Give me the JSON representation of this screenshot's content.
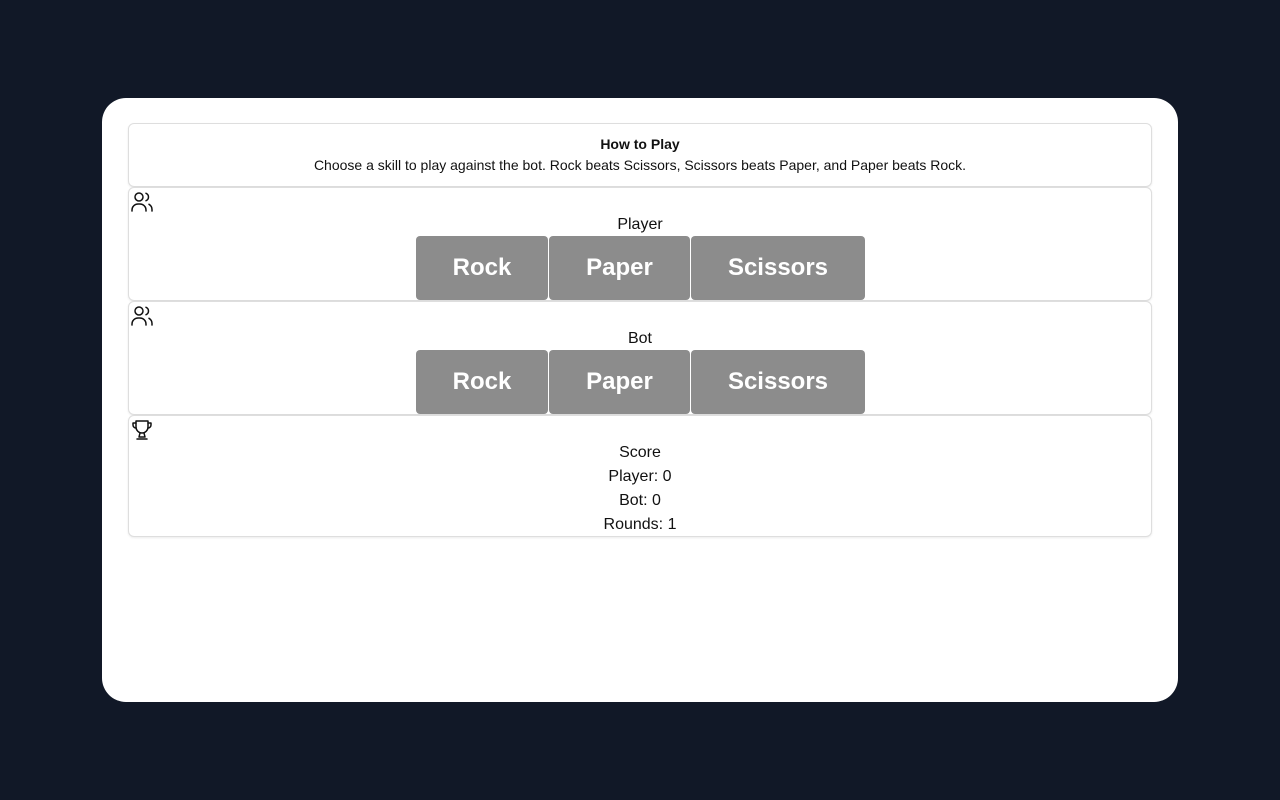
{
  "how_to_play": {
    "title": "How to Play",
    "text": "Choose a skill to play against the bot. Rock beats Scissors, Scissors beats Paper, and Paper beats Rock."
  },
  "player_section": {
    "icon": "users-icon",
    "title": "Player",
    "choices": [
      "Rock",
      "Paper",
      "Scissors"
    ]
  },
  "bot_section": {
    "icon": "users-icon",
    "title": "Bot",
    "choices": [
      "Rock",
      "Paper",
      "Scissors"
    ]
  },
  "score_section": {
    "icon": "trophy-icon",
    "title": "Score",
    "player_line": "Player: 0",
    "bot_line": "Bot: 0",
    "rounds_line": "Rounds: 1"
  },
  "colors": {
    "page_background": "#111827",
    "card_background": "#ffffff",
    "button_background": "#8c8c8c",
    "button_text": "#ffffff"
  }
}
